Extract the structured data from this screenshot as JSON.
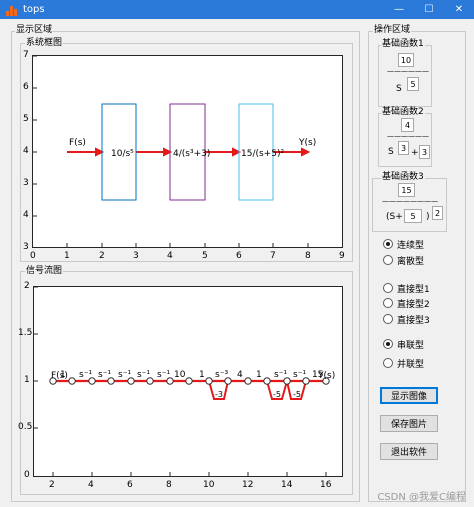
{
  "window": {
    "title": "tops",
    "minimize": "—",
    "maximize": "☐",
    "close": "✕"
  },
  "display": {
    "panel_label": "显示区域",
    "system_label": "系统框图",
    "signal_label": "信号流图"
  },
  "system_diagram": {
    "xticks": [
      "0",
      "1",
      "2",
      "3",
      "4",
      "5",
      "6",
      "7",
      "8",
      "9"
    ],
    "yticks": [
      "7",
      "6",
      "5",
      "4",
      "3"
    ],
    "input_label": "F(s)",
    "output_label": "Y(s)",
    "blocks": [
      {
        "text": "10/s⁵",
        "color": "#0072bd"
      },
      {
        "text": "4/(s³+3)",
        "color": "#7e2f8e"
      },
      {
        "text": "15/(s+5)²",
        "color": "#4dbeee"
      }
    ]
  },
  "signal_flow": {
    "xticks": [
      "2",
      "4",
      "6",
      "8",
      "10",
      "12",
      "14",
      "16"
    ],
    "yticks": [
      "2",
      "1.5",
      "1",
      "0.5",
      "0"
    ],
    "input_label": "F(s)",
    "output_label": "Y(s)",
    "gain_labels": [
      "1",
      "s⁻¹",
      "s⁻¹",
      "s⁻¹",
      "s⁻¹",
      "s⁻¹",
      "10",
      "1",
      "s⁻³",
      "4",
      "1",
      "s⁻¹",
      "s⁻¹",
      "15"
    ],
    "feedback_labels": [
      "-3",
      "-5",
      "-5"
    ]
  },
  "operation": {
    "panel_label": "操作区域",
    "func1": {
      "label": "基础函数1",
      "numerator": "10",
      "dash": "——————",
      "prefix": "S",
      "box": "5"
    },
    "func2": {
      "label": "基础函数2",
      "numerator": "4",
      "dash": "——————",
      "prefix": "S",
      "box1": "3",
      "plus": "+",
      "box2": "3"
    },
    "func3": {
      "label": "基础函数3",
      "numerator": "15",
      "dash": "————————",
      "open": "(S+",
      "box1": "5",
      "close": ")",
      "box2": "2"
    }
  },
  "radios": {
    "continuous": "连续型",
    "discrete": "离散型",
    "direct1": "直接型1",
    "direct2": "直接型2",
    "direct3": "直接型3",
    "series": "串联型",
    "parallel": "并联型"
  },
  "buttons": {
    "show": "显示图像",
    "save": "保存图片",
    "exit": "退出软件"
  },
  "watermark": "CSDN @我爱C编程"
}
